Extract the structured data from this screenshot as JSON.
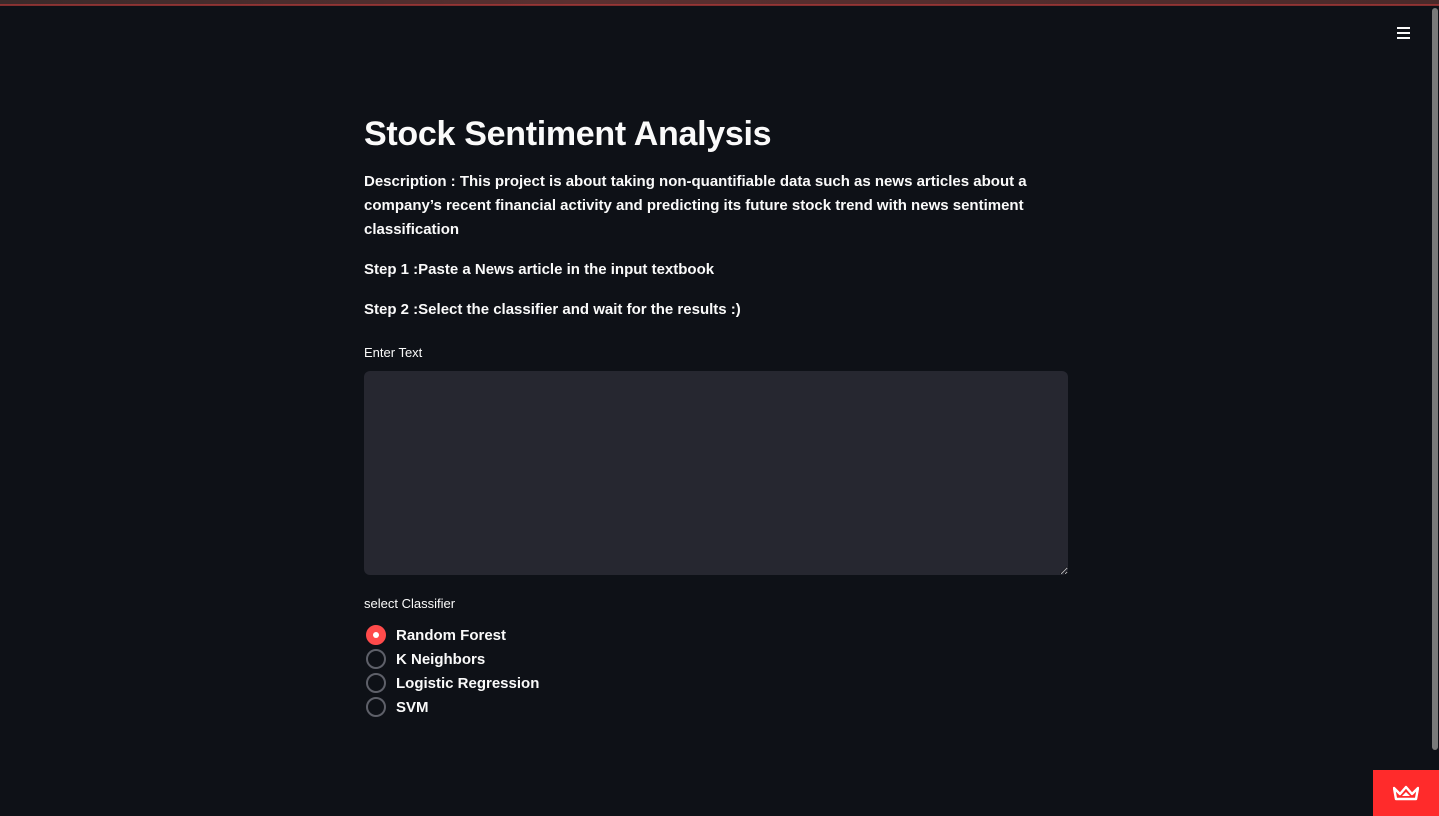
{
  "header": {
    "menu_icon": "hamburger-menu-icon"
  },
  "main": {
    "title": "Stock Sentiment Analysis",
    "description": "Description : This project is about taking non-quantifiable data such as news articles about a company’s recent financial activity and predicting its future stock trend with news sentiment classification",
    "step1": "Step 1 :Paste a News article in the input textbook",
    "step2": "Step 2 :Select the classifier and wait for the results :)",
    "text_input": {
      "label": "Enter Text",
      "value": ""
    },
    "classifier": {
      "label": "select Classifier",
      "selected": "Random Forest",
      "options": [
        "Random Forest",
        "K Neighbors",
        "Logistic Regression",
        "SVM"
      ]
    }
  },
  "footer": {
    "badge_icon": "streamlit-crown-icon",
    "accent_color": "#ff4b4b"
  }
}
